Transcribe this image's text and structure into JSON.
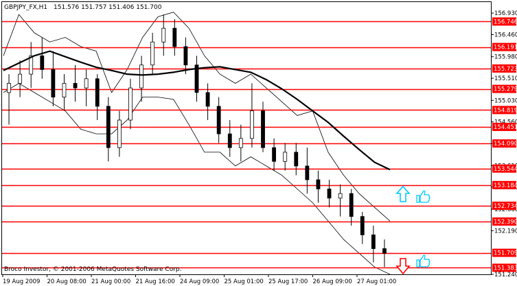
{
  "header": {
    "symbol": "GBPJPY_FX,H1",
    "ohlc": "151.576 151.757 151.406 151.700"
  },
  "footer": {
    "copyright": "Broco Investor, © 2001-2006 MetaQuotes Software Corp."
  },
  "colors": {
    "level_line": "#ff0000",
    "level_box": "#ff0000",
    "candle": "#000000",
    "ma": "#000000",
    "bands": "#000000",
    "arrow_up": "#00c8ff",
    "arrow_down": "#ff0000",
    "thumb": "#00c8ff"
  },
  "icons": {
    "up_arrow": "up-arrow-icon",
    "down_arrow": "down-arrow-icon",
    "thumbs_up_upper": "thumbs-up-icon",
    "thumbs_up_lower": "thumbs-up-icon"
  },
  "chart_data": {
    "type": "candlestick",
    "y_axis": {
      "ylim": [
        151.24,
        157.17
      ],
      "ticks": [
        "156.930",
        "156.460",
        "155.980",
        "155.510",
        "155.030",
        "154.560",
        "154.090",
        "153.610",
        "153.140",
        "152.660",
        "152.190",
        "151.240"
      ],
      "tick_values": [
        156.93,
        156.46,
        155.98,
        155.51,
        155.03,
        154.56,
        154.09,
        153.61,
        153.14,
        152.66,
        152.19,
        151.24
      ]
    },
    "x_axis": {
      "labels": [
        "19 Aug 2009",
        "20 Aug 08:00",
        "21 Aug 00:00",
        "21 Aug 16:00",
        "24 Aug 09:00",
        "25 Aug 01:00",
        "25 Aug 17:00",
        "26 Aug 09:00",
        "27 Aug 01:00"
      ]
    },
    "levels": [
      {
        "value": 156.746,
        "label": "156.746"
      },
      {
        "value": 156.191,
        "label": "156.191"
      },
      {
        "value": 155.723,
        "label": "155.723"
      },
      {
        "value": 155.279,
        "label": "155.279"
      },
      {
        "value": 154.819,
        "label": "154.819"
      },
      {
        "value": 154.451,
        "label": "154.451"
      },
      {
        "value": 154.09,
        "label": "154.090"
      },
      {
        "value": 153.544,
        "label": "153.544"
      },
      {
        "value": 153.184,
        "label": "153.184"
      },
      {
        "value": 152.734,
        "label": "152.734"
      },
      {
        "value": 152.39,
        "label": "152.390"
      },
      {
        "value": 151.709,
        "label": "151.709"
      },
      {
        "value": 151.383,
        "label": "151.383"
      }
    ],
    "ma_points": [
      155.68,
      155.84,
      156.0,
      156.1,
      155.98,
      155.86,
      155.75,
      155.68,
      155.6,
      155.58,
      155.6,
      155.64,
      155.7,
      155.74,
      155.76,
      155.7,
      155.64,
      155.48,
      155.28,
      155.05,
      154.8,
      154.55,
      154.25,
      153.96,
      153.68,
      153.52
    ],
    "upper_band": [
      156.0,
      156.9,
      156.5,
      156.3,
      156.4,
      156.2,
      156.1,
      155.2,
      155.7,
      156.4,
      156.85,
      156.95,
      156.6,
      156.0,
      155.6,
      155.4,
      155.6,
      155.3,
      155.0,
      154.7,
      154.8,
      153.9,
      153.4,
      153.0,
      152.7,
      152.4
    ],
    "lower_band": [
      155.2,
      155.4,
      155.2,
      155.0,
      154.8,
      154.4,
      154.3,
      154.3,
      154.6,
      155.1,
      155.1,
      155.05,
      154.5,
      153.9,
      153.9,
      153.6,
      153.8,
      153.6,
      153.4,
      153.1,
      152.8,
      152.4,
      152.0,
      151.7,
      151.4,
      151.24
    ],
    "candles": [
      {
        "o": 155.2,
        "h": 155.6,
        "l": 154.5,
        "c": 155.4
      },
      {
        "o": 155.4,
        "h": 155.9,
        "l": 155.1,
        "c": 155.6
      },
      {
        "o": 155.6,
        "h": 156.3,
        "l": 155.3,
        "c": 156.0
      },
      {
        "o": 156.0,
        "h": 156.4,
        "l": 155.5,
        "c": 155.7
      },
      {
        "o": 155.7,
        "h": 156.1,
        "l": 154.9,
        "c": 155.1
      },
      {
        "o": 155.1,
        "h": 155.6,
        "l": 154.8,
        "c": 155.4
      },
      {
        "o": 155.4,
        "h": 155.8,
        "l": 155.0,
        "c": 155.3
      },
      {
        "o": 155.3,
        "h": 155.7,
        "l": 154.9,
        "c": 155.5
      },
      {
        "o": 155.5,
        "h": 155.6,
        "l": 154.6,
        "c": 154.9
      },
      {
        "o": 154.9,
        "h": 155.1,
        "l": 153.7,
        "c": 154.0
      },
      {
        "o": 154.0,
        "h": 154.8,
        "l": 153.8,
        "c": 154.6
      },
      {
        "o": 154.6,
        "h": 155.5,
        "l": 154.4,
        "c": 155.3
      },
      {
        "o": 155.3,
        "h": 156.0,
        "l": 155.0,
        "c": 155.8
      },
      {
        "o": 155.8,
        "h": 156.5,
        "l": 155.6,
        "c": 156.3
      },
      {
        "o": 156.3,
        "h": 156.9,
        "l": 156.0,
        "c": 156.6
      },
      {
        "o": 156.6,
        "h": 156.8,
        "l": 156.0,
        "c": 156.2
      },
      {
        "o": 156.2,
        "h": 156.4,
        "l": 155.6,
        "c": 155.8
      },
      {
        "o": 155.8,
        "h": 156.0,
        "l": 155.0,
        "c": 155.2
      },
      {
        "o": 155.2,
        "h": 155.4,
        "l": 154.6,
        "c": 154.9
      },
      {
        "o": 154.9,
        "h": 155.1,
        "l": 154.1,
        "c": 154.3
      },
      {
        "o": 154.3,
        "h": 154.6,
        "l": 153.8,
        "c": 154.0
      },
      {
        "o": 154.0,
        "h": 154.5,
        "l": 153.7,
        "c": 154.2
      },
      {
        "o": 154.2,
        "h": 155.4,
        "l": 154.0,
        "c": 154.8
      },
      {
        "o": 154.8,
        "h": 155.0,
        "l": 153.9,
        "c": 154.0
      },
      {
        "o": 154.0,
        "h": 154.2,
        "l": 153.5,
        "c": 153.7
      },
      {
        "o": 153.7,
        "h": 154.1,
        "l": 153.5,
        "c": 153.9
      },
      {
        "o": 153.9,
        "h": 154.1,
        "l": 153.4,
        "c": 153.6
      },
      {
        "o": 153.6,
        "h": 154.0,
        "l": 153.0,
        "c": 153.3
      },
      {
        "o": 153.3,
        "h": 153.5,
        "l": 152.8,
        "c": 153.1
      },
      {
        "o": 153.1,
        "h": 153.3,
        "l": 152.7,
        "c": 152.9
      },
      {
        "o": 152.9,
        "h": 153.2,
        "l": 152.5,
        "c": 153.0
      },
      {
        "o": 153.0,
        "h": 153.1,
        "l": 152.3,
        "c": 152.5
      },
      {
        "o": 152.5,
        "h": 152.6,
        "l": 151.9,
        "c": 152.1
      },
      {
        "o": 152.1,
        "h": 152.3,
        "l": 151.5,
        "c": 151.8
      },
      {
        "o": 151.8,
        "h": 152.0,
        "l": 151.4,
        "c": 151.7
      }
    ]
  }
}
